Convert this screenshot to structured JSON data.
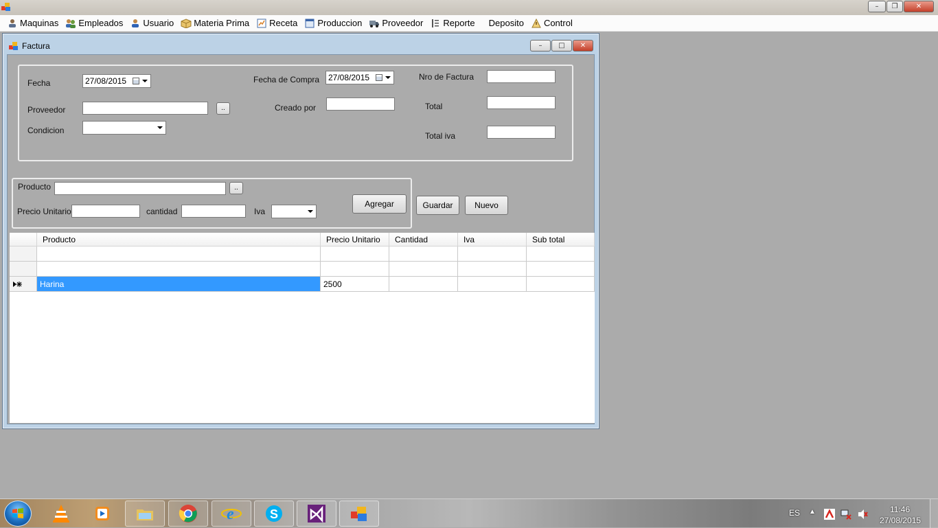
{
  "menubar": {
    "items": [
      {
        "label": "Maquinas",
        "icon": "user-machine-icon"
      },
      {
        "label": "Empleados",
        "icon": "users-icon"
      },
      {
        "label": "Usuario",
        "icon": "user-icon"
      },
      {
        "label": "Materia Prima",
        "icon": "box-icon"
      },
      {
        "label": "Receta",
        "icon": "recipe-icon"
      },
      {
        "label": "Produccion",
        "icon": "window-icon"
      },
      {
        "label": "Proveedor",
        "icon": "truck-icon"
      },
      {
        "label": "Reporte",
        "icon": "report-icon"
      },
      {
        "label": "Deposito",
        "icon": ""
      },
      {
        "label": "Control",
        "icon": "control-icon"
      }
    ]
  },
  "window": {
    "title": "Factura"
  },
  "form": {
    "fecha_label": "Fecha",
    "fecha_value": "27/08/2015",
    "proveedor_label": "Proveedor",
    "proveedor_value": "",
    "condicion_label": "Condicion",
    "condicion_value": "",
    "fecha_compra_label": "Fecha de Compra",
    "fecha_compra_value": "27/08/2015",
    "creado_por_label": "Creado por",
    "creado_por_value": "",
    "nro_factura_label": "Nro de Factura",
    "nro_factura_value": "",
    "total_label": "Total",
    "total_value": "",
    "total_iva_label": "Total iva",
    "total_iva_value": "",
    "browse_label": ".."
  },
  "item_entry": {
    "producto_label": "Producto",
    "producto_value": "",
    "precio_unitario_label": "Precio Unitario",
    "precio_unitario_value": "",
    "cantidad_label": "cantidad",
    "cantidad_value": "",
    "iva_label": "Iva",
    "iva_value": "",
    "browse_label": "..",
    "agregar_label": "Agregar"
  },
  "actions": {
    "guardar_label": "Guardar",
    "nuevo_label": "Nuevo"
  },
  "grid": {
    "columns": [
      "Producto",
      "Precio Unitario",
      "Cantidad",
      "Iva",
      "Sub total"
    ],
    "rows": [
      {
        "producto": "",
        "precio": "",
        "cantidad": "",
        "iva": "",
        "subtotal": ""
      },
      {
        "producto": "",
        "precio": "",
        "cantidad": "",
        "iva": "",
        "subtotal": ""
      },
      {
        "producto": "Harina",
        "precio": "2500",
        "cantidad": "",
        "iva": "",
        "subtotal": ""
      }
    ]
  },
  "taskbar": {
    "language": "ES",
    "time": "11:46",
    "date": "27/08/2015",
    "apps": [
      "vlc-icon",
      "media-player-icon",
      "file-explorer-icon",
      "chrome-icon",
      "internet-explorer-icon",
      "skype-icon",
      "visual-studio-icon",
      "winforms-app-icon"
    ]
  }
}
